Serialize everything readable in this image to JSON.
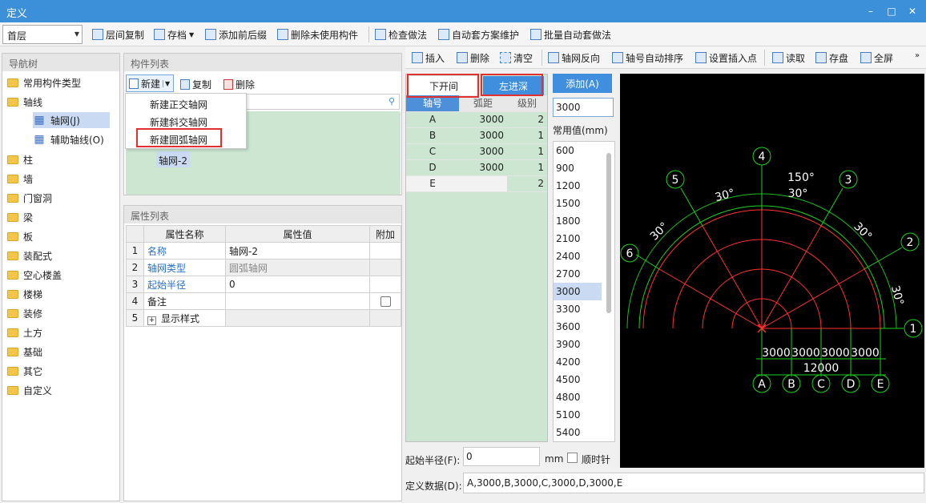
{
  "window": {
    "title": "定义",
    "min_icon": "minimize-icon",
    "max_icon": "maximize-icon",
    "close_icon": "close-icon"
  },
  "toolbar": {
    "floor_value": "首层",
    "items": [
      "层间复制",
      "存档",
      "添加前后缀",
      "删除未使用构件",
      "检查做法",
      "自动套方案维护",
      "批量自动套做法"
    ]
  },
  "nav": {
    "title": "导航树",
    "items": [
      {
        "label": "常用构件类型"
      },
      {
        "label": "轴线"
      },
      {
        "label": "轴网(J)"
      },
      {
        "label": "辅助轴线(O)"
      },
      {
        "label": "柱"
      },
      {
        "label": "墙"
      },
      {
        "label": "门窗洞"
      },
      {
        "label": "梁"
      },
      {
        "label": "板"
      },
      {
        "label": "装配式"
      },
      {
        "label": "空心楼盖"
      },
      {
        "label": "楼梯"
      },
      {
        "label": "装修"
      },
      {
        "label": "土方"
      },
      {
        "label": "基础"
      },
      {
        "label": "其它"
      },
      {
        "label": "自定义"
      }
    ]
  },
  "component_list": {
    "title": "构件列表",
    "new_label": "新建",
    "copy_label": "复制",
    "delete_label": "删除",
    "menu": [
      "新建正交轴网",
      "新建斜交轴网",
      "新建圆弧轴网"
    ],
    "selected_item": "轴网-2"
  },
  "props": {
    "title": "属性列表",
    "headers": [
      "属性名称",
      "属性值",
      "附加"
    ],
    "rows": [
      {
        "idx": "1",
        "name": "名称",
        "value": "轴网-2"
      },
      {
        "idx": "2",
        "name": "轴网类型",
        "value": "圆弧轴网"
      },
      {
        "idx": "3",
        "name": "起始半径",
        "value": "0"
      },
      {
        "idx": "4",
        "name": "备注",
        "value": ""
      },
      {
        "idx": "5",
        "name": "显示样式",
        "value": ""
      }
    ]
  },
  "editor": {
    "toolbar": [
      "插入",
      "删除",
      "清空",
      "轴网反向",
      "轴号自动排序",
      "设置插入点",
      "读取",
      "存盘",
      "全屏"
    ],
    "tabs": [
      "下开间",
      "左进深"
    ],
    "grid_headers": [
      "轴号",
      "弧距",
      "级别"
    ],
    "grid_rows": [
      {
        "axis": "A",
        "dist": "3000",
        "level": "2"
      },
      {
        "axis": "B",
        "dist": "3000",
        "level": "1"
      },
      {
        "axis": "C",
        "dist": "3000",
        "level": "1"
      },
      {
        "axis": "D",
        "dist": "3000",
        "level": "1"
      },
      {
        "axis": "E",
        "dist": "",
        "level": "2"
      }
    ],
    "add_label": "添加(A)",
    "value_input": "3000",
    "common_label": "常用值(mm)",
    "common_values": [
      "600",
      "900",
      "1200",
      "1500",
      "1800",
      "2100",
      "2400",
      "2700",
      "3000",
      "3300",
      "3600",
      "3900",
      "4200",
      "4500",
      "4800",
      "5100",
      "5400"
    ],
    "selected_common": "3000",
    "start_radius_label": "起始半径(F):",
    "start_radius_value": "0",
    "unit": "mm",
    "clockwise_label": "顺时针",
    "def_label": "定义数据(D):",
    "def_value": "A,3000,B,3000,C,3000,D,3000,E"
  },
  "canvas": {
    "radial_labels": [
      "1",
      "2",
      "3",
      "4",
      "5",
      "6"
    ],
    "angle_labels": [
      "30°",
      "30°",
      "30°",
      "30°",
      "30°",
      "150°"
    ],
    "arc_labels": [
      "A",
      "B",
      "C",
      "D",
      "E"
    ],
    "dim_labels": [
      "3000",
      "3000",
      "3000",
      "3000"
    ],
    "total_label": "12000"
  }
}
